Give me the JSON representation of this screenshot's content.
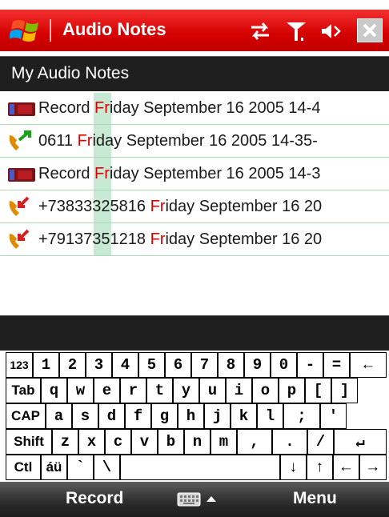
{
  "titlebar": {
    "app_title": "Audio Notes",
    "icons": [
      "windows-logo",
      "connectivity-icon",
      "signal-icon",
      "volume-icon",
      "close-icon"
    ]
  },
  "folder": {
    "label": "My Audio Notes"
  },
  "list": {
    "items": [
      {
        "icon": "record-icon",
        "prefix": "Record ",
        "hl": "Fr",
        "rest": "iday September 16 2005 14-4"
      },
      {
        "icon": "outgoing-call-icon",
        "prefix": "0611 ",
        "hl": "Fr",
        "rest": "iday September 16 2005 14-35-"
      },
      {
        "icon": "record-icon",
        "prefix": "Record ",
        "hl": "Fr",
        "rest": "iday September 16 2005 14-3"
      },
      {
        "icon": "incoming-call-icon",
        "prefix": "+73833325816 ",
        "hl": "Fr",
        "rest": "iday September 16 20"
      },
      {
        "icon": "incoming-call-icon",
        "prefix": "+79137351218 ",
        "hl": "Fr",
        "rest": "iday September 16 20"
      }
    ]
  },
  "keyboard": {
    "rows": [
      [
        "123",
        "1",
        "2",
        "3",
        "4",
        "5",
        "6",
        "7",
        "8",
        "9",
        "0",
        "-",
        "=",
        "←"
      ],
      [
        "Tab",
        "q",
        "w",
        "e",
        "r",
        "t",
        "y",
        "u",
        "i",
        "o",
        "p",
        "[",
        "]"
      ],
      [
        "CAP",
        "a",
        "s",
        "d",
        "f",
        "g",
        "h",
        "j",
        "k",
        "l",
        ";",
        "'"
      ],
      [
        "Shift",
        "z",
        "x",
        "c",
        "v",
        "b",
        "n",
        "m",
        ",",
        ".",
        "/",
        "↵"
      ],
      [
        "Ctl",
        "áü",
        "`",
        "\\",
        "",
        "↓",
        "↑",
        "←",
        "→"
      ]
    ]
  },
  "menubar": {
    "left_softkey": "Record",
    "right_softkey": "Menu",
    "input_icon": "keyboard-icon"
  },
  "colors": {
    "title_red": "#d40000",
    "highlight_green": "#c8ead4",
    "match_red": "#e00000"
  }
}
